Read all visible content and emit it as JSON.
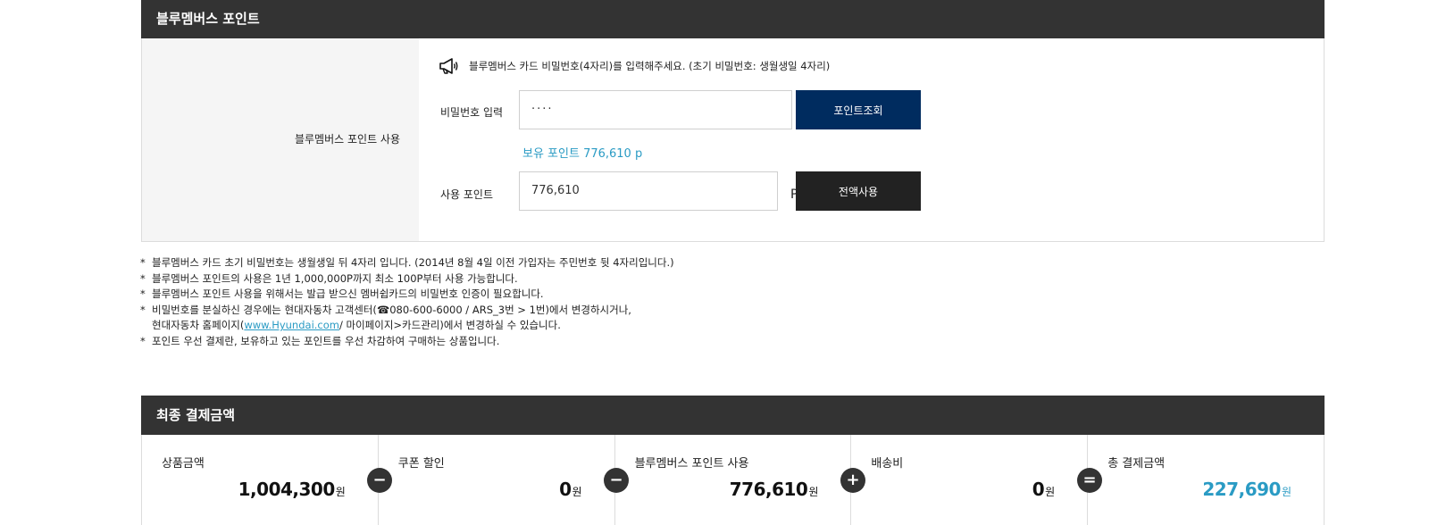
{
  "points_section": {
    "title": "블루멤버스 포인트",
    "label": "블루멤버스 포인트 사용",
    "notice": "블루멤버스 카드 비밀번호(4자리)를 입력해주세요. (초기 비밀번호: 생월생일 4자리)",
    "password_label": "비밀번호 입력",
    "password_value": "····",
    "lookup_button": "포인트조회",
    "owned_points": "보유 포인트 776,610 p",
    "use_label": "사용 포인트",
    "use_value": "776,610",
    "use_unit": "P",
    "use_all_button": "전액사용"
  },
  "notes": {
    "star": "*",
    "n1": "블루멤버스 카드 초기 비밀번호는 생월생일 뒤 4자리 입니다. (2014년 8월 4일 이전 가입자는 주민번호 뒷 4자리입니다.)",
    "n2": "블루멤버스 포인트의 사용은 1년 1,000,000P까지 최소 100P부터 사용 가능합니다.",
    "n3": "블루멤버스 포인트 사용을 위해서는 발급 받으신 멤버쉽카드의 비밀번호 인증이 필요합니다.",
    "n4a": "비밀번호를 분실하신 경우에는 현대자동차 고객센터(☎080-600-6000 / ARS_3번 > 1번)에서 변경하시거나,",
    "n4b_pre": "현대자동차 홈페이지(",
    "n4b_link": "www.Hyundai.com",
    "n4b_post": " / 마이페이지>카드관리)에서 변경하실 수 있습니다.",
    "n5": "포인트 우선 결제란, 보유하고 있는 포인트를 우선 차감하여 구매하는 상품입니다."
  },
  "payment": {
    "title": "최종 결제금액",
    "won": "원",
    "items": [
      {
        "label": "상품금액",
        "value": "1,004,300"
      },
      {
        "label": "쿠폰 할인",
        "value": "0"
      },
      {
        "label": "블루멤버스 포인트 사용",
        "value": "776,610"
      },
      {
        "label": "배송비",
        "value": "0"
      },
      {
        "label": "총 결제금액",
        "value": "227,690"
      }
    ],
    "operators": [
      "−",
      "−",
      "+",
      "="
    ]
  },
  "colors": {
    "header_bg": "#333333",
    "navy": "#002c5f",
    "accent": "#2a9bc4"
  },
  "icons": {
    "notice": "megaphone-icon"
  }
}
